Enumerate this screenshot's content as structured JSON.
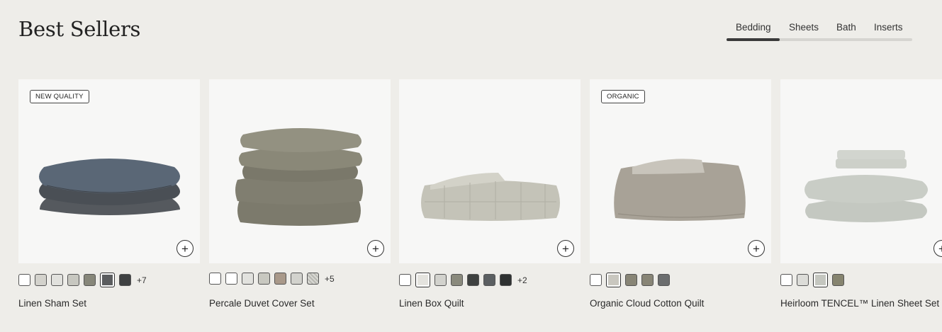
{
  "section": {
    "title": "Best Sellers"
  },
  "tabs": [
    {
      "label": "Bedding"
    },
    {
      "label": "Sheets"
    },
    {
      "label": "Bath"
    },
    {
      "label": "Inserts"
    }
  ],
  "products": [
    {
      "name": "Linen Sham Set",
      "badge": "NEW QUALITY",
      "more": "+7",
      "swatches": [
        "#ffffff",
        "#d3d2cc",
        "#e1e1dd",
        "#c7c7c0",
        "#87877a",
        "#5b5d5f",
        "#3f4142"
      ]
    },
    {
      "name": "Percale Duvet Cover Set",
      "badge": "",
      "more": "+5",
      "swatches": [
        "#ffffff",
        "#ffffff",
        "#e2e2de",
        "#c8c8c0",
        "#a9998a",
        "#d2d2cd",
        "#b8b8b2"
      ]
    },
    {
      "name": "Linen Box Quilt",
      "badge": "",
      "more": "+2",
      "swatches": [
        "#ffffff",
        "#e4e3de",
        "#d2d2cd",
        "#8a8a7d",
        "#3e4140",
        "#5b5f62",
        "#2f3232"
      ]
    },
    {
      "name": "Organic Cloud Cotton Quilt",
      "badge": "ORGANIC",
      "more": "",
      "swatches": [
        "#ffffff",
        "#c9c7bf",
        "#888576",
        "#888576",
        "#6b6d6e"
      ]
    },
    {
      "name": "Heirloom TENCEL™ Linen Sheet Set",
      "badge": "",
      "more": "",
      "swatches": [
        "#ffffff",
        "#dcdcd8",
        "#c4c6bf",
        "#86846f"
      ]
    }
  ],
  "icons": {
    "add": "plus-circle-icon"
  }
}
